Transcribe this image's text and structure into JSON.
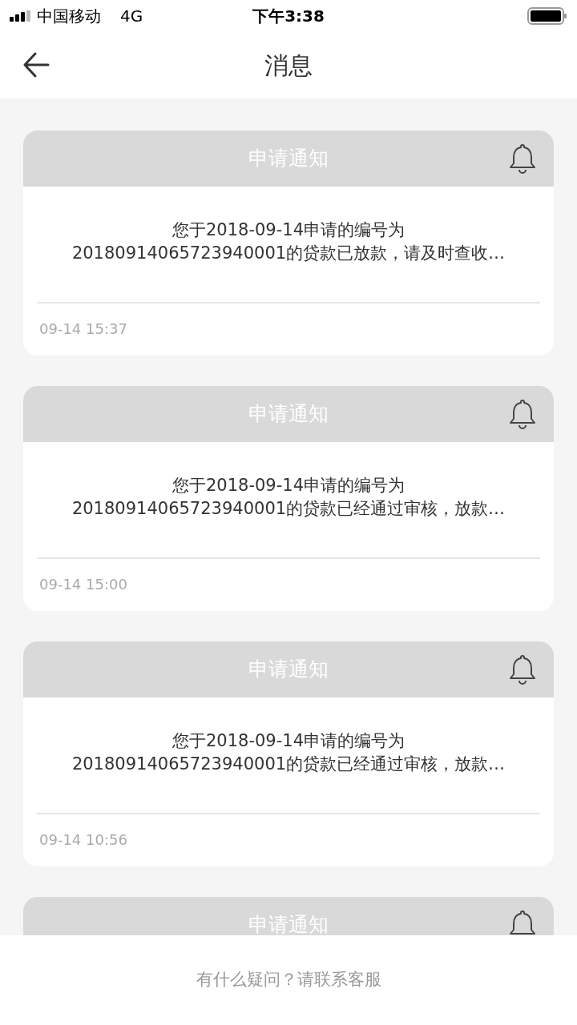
{
  "status_bar": {
    "carrier": "中国移动",
    "network": "4G",
    "time": "下午3:38"
  },
  "nav": {
    "title": "消息"
  },
  "messages": [
    {
      "title": "申请通知",
      "text": "您于2018-09-14申请的编号为\n20180914065723940001的贷款已放款，请及时查收…",
      "time": "09-14 15:37"
    },
    {
      "title": "申请通知",
      "text": "您于2018-09-14申请的编号为\n20180914065723940001的贷款已经通过审核，放款…",
      "time": "09-14 15:00"
    },
    {
      "title": "申请通知",
      "text": "您于2018-09-14申请的编号为\n20180914065723940001的贷款已经通过审核，放款…",
      "time": "09-14 10:56"
    },
    {
      "title": "申请通知"
    }
  ],
  "footer": {
    "text": "有什么疑问？请联系客服"
  }
}
